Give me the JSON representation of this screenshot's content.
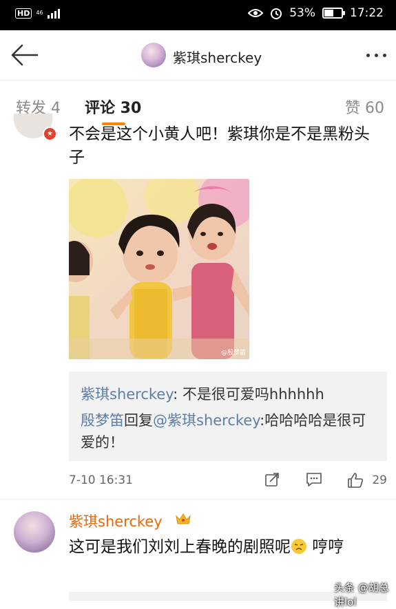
{
  "status_bar": {
    "hd": "HD",
    "network": "46",
    "battery": "53%",
    "battery_level": 0.53,
    "time": "17:22"
  },
  "header": {
    "title": "紫琪sherckey"
  },
  "tabs": {
    "repost": "转发 4",
    "comment": "评论 30",
    "like": "赞 60"
  },
  "comment1": {
    "text": "不会是这个小黄人吧！紫琪你是不是黑粉头子",
    "photo_watermark": "@殷梦笛",
    "reply1": {
      "user": "紫琪sherckey",
      "separator": ": ",
      "text": "不是很可爱吗hhhhhh"
    },
    "reply2": {
      "user": "殷梦笛",
      "action": "回复",
      "mention": "@紫琪sherckey",
      "text": ":哈哈哈哈是很可爱的！"
    },
    "time": "7-10 16:31",
    "likes": "29"
  },
  "comment2": {
    "user": "紫琪sherckey",
    "text": "这可是我们刘刘上春晚的剧照呢",
    "text_tail": " 哼哼"
  },
  "watermark": "头条 @胡总讲lol",
  "colors": {
    "accent": "#ff8200",
    "link": "#5b7ea9",
    "username": "#e8690a"
  }
}
